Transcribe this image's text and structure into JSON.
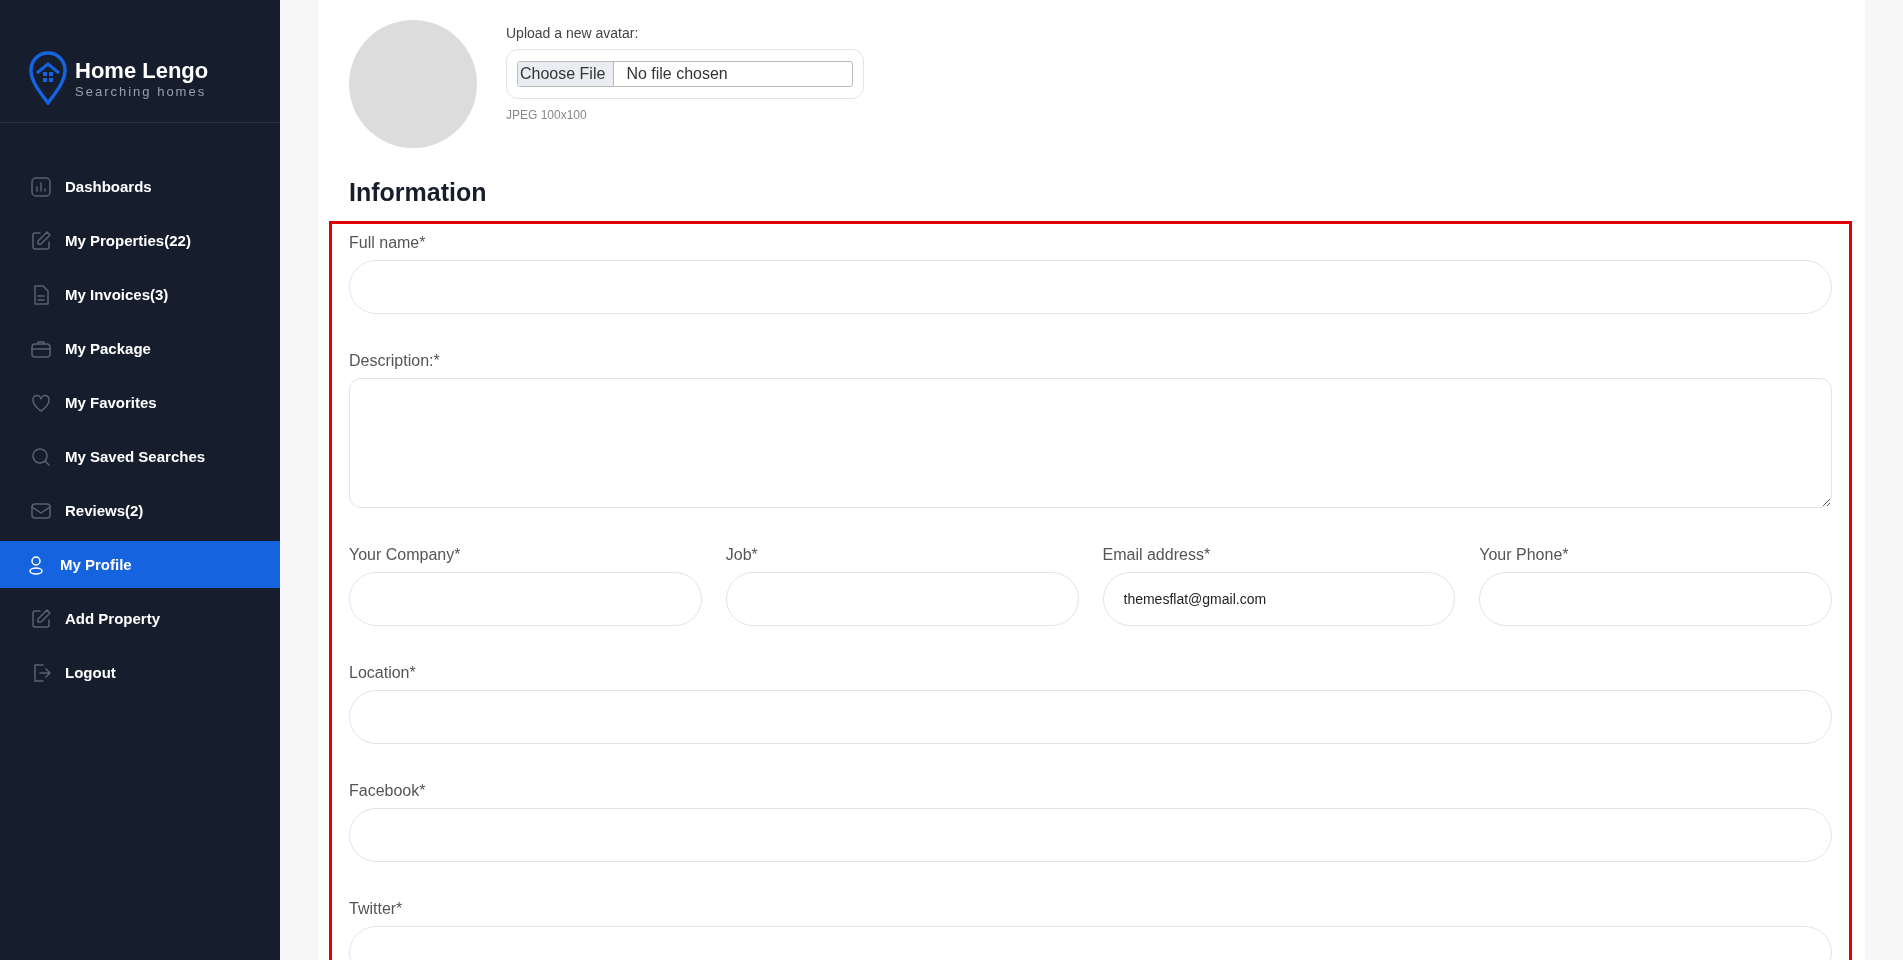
{
  "brand": {
    "name": "Home Lengo",
    "tagline": "Searching homes"
  },
  "sidebar": {
    "items": [
      {
        "label": "Dashboards",
        "selected": false
      },
      {
        "label": "My Properties(22)",
        "selected": false
      },
      {
        "label": "My Invoices(3)",
        "selected": false
      },
      {
        "label": "My Package",
        "selected": false
      },
      {
        "label": "My Favorites",
        "selected": false
      },
      {
        "label": "My Saved Searches",
        "selected": false
      },
      {
        "label": "Reviews(2)",
        "selected": false
      },
      {
        "label": "My Profile",
        "selected": true
      },
      {
        "label": "Add Property",
        "selected": false
      },
      {
        "label": "Logout",
        "selected": false
      }
    ]
  },
  "avatar": {
    "upload_label": "Upload a new avatar:",
    "choose_button": "Choose File",
    "file_status": "No file chosen",
    "hint": "JPEG 100x100"
  },
  "information": {
    "title": "Information",
    "rows": [
      [
        {
          "label": "Full name*",
          "kind": "text"
        }
      ],
      [
        {
          "label": "Description:*",
          "kind": "textarea"
        }
      ],
      [
        {
          "label": "Your Company*",
          "kind": "text"
        },
        {
          "label": "Job*",
          "kind": "text"
        },
        {
          "label": "Email address*",
          "kind": "text",
          "value": "themesflat@gmail.com"
        },
        {
          "label": "Your Phone*",
          "kind": "text"
        }
      ],
      [
        {
          "label": "Location*",
          "kind": "text"
        }
      ],
      [
        {
          "label": "Facebook*",
          "kind": "text"
        }
      ],
      [
        {
          "label": "Twitter*",
          "kind": "text"
        }
      ]
    ]
  }
}
